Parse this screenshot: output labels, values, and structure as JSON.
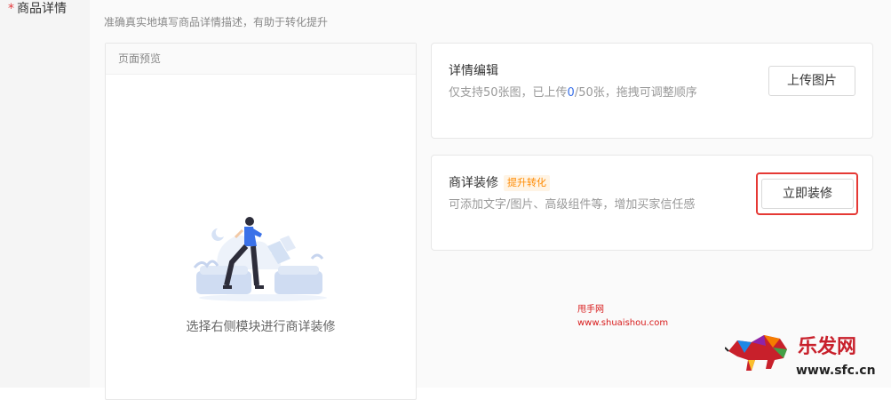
{
  "form": {
    "required_mark": "*",
    "label": "商品详情",
    "helper_text": "准确真实地填写商品详情描述，有助于转化提升"
  },
  "preview": {
    "header": "页面预览",
    "empty_hint": "选择右侧模块进行商详装修"
  },
  "detail_edit": {
    "title": "详情编辑",
    "desc_prefix": "仅支持50张图，已上传",
    "uploaded_count": "0",
    "desc_suffix": "/50张，拖拽可调整顺序",
    "button": "上传图片"
  },
  "decoration": {
    "title": "商详装修",
    "tag": "提升转化",
    "desc": "可添加文字/图片、高级组件等，增加买家信任感",
    "button": "立即装修"
  },
  "watermark": {
    "line1": "甩手网",
    "line2": "www.shuaishou.com",
    "logo_text": "乐发网",
    "logo_url": "www.sfc.cn"
  },
  "colors": {
    "accent_blue": "#3a71e8",
    "highlight_red": "#e53935",
    "tag_orange": "#ff8a00"
  }
}
